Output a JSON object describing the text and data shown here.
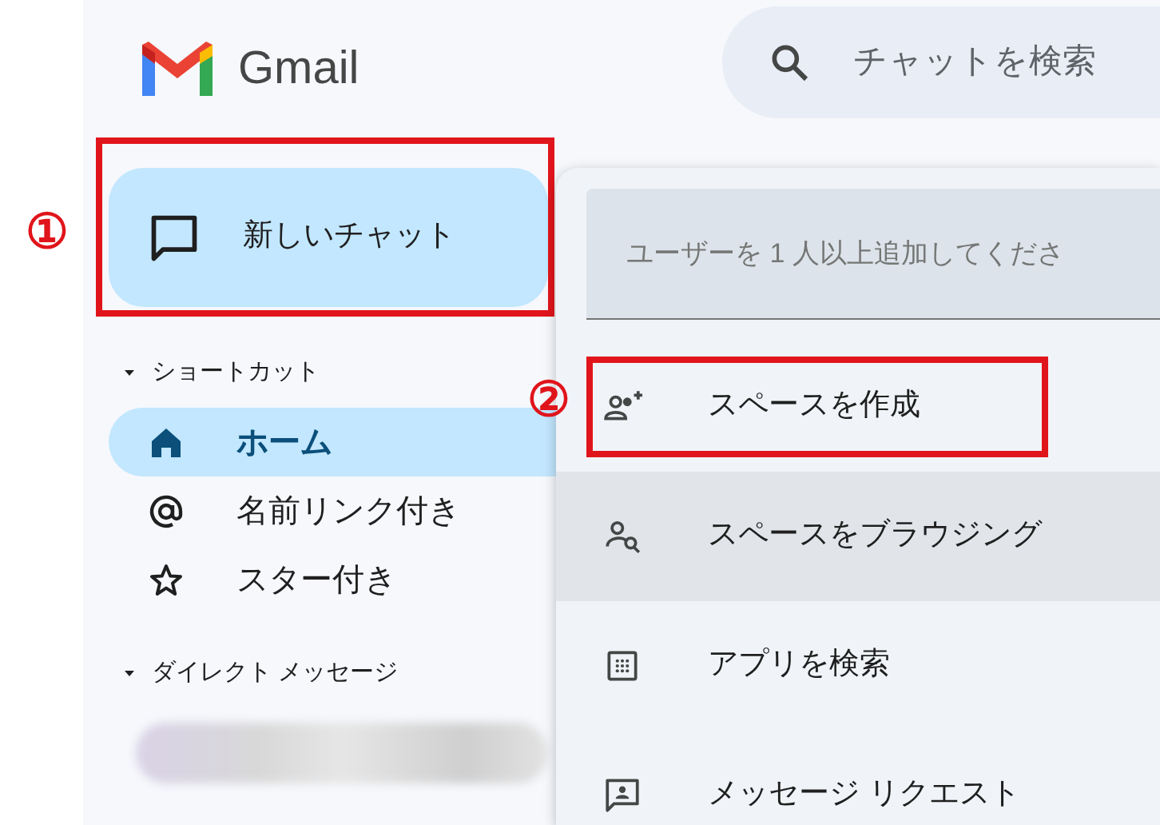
{
  "app": {
    "name": "Gmail"
  },
  "search": {
    "placeholder": "チャットを検索"
  },
  "new_chat_button": {
    "label": "新しいチャット",
    "marker": "①"
  },
  "sections": [
    {
      "title": "ショートカット",
      "expanded": true,
      "items": [
        {
          "label": "ホーム",
          "selected": true
        },
        {
          "label": "名前リンク付き",
          "selected": false
        },
        {
          "label": "スター付き",
          "selected": false
        }
      ]
    },
    {
      "title": "ダイレクト メッセージ",
      "expanded": true
    }
  ],
  "menu": {
    "field": {
      "placeholder": "ユーザーを 1 人以上追加してくださ"
    },
    "items": [
      {
        "label": "スペースを作成",
        "highlighted": false,
        "marker": "②"
      },
      {
        "label": "スペースをブラウジング",
        "highlighted": true
      },
      {
        "label": "アプリを検索",
        "highlighted": false
      },
      {
        "label": "メッセージ リクエスト",
        "highlighted": false
      }
    ]
  }
}
